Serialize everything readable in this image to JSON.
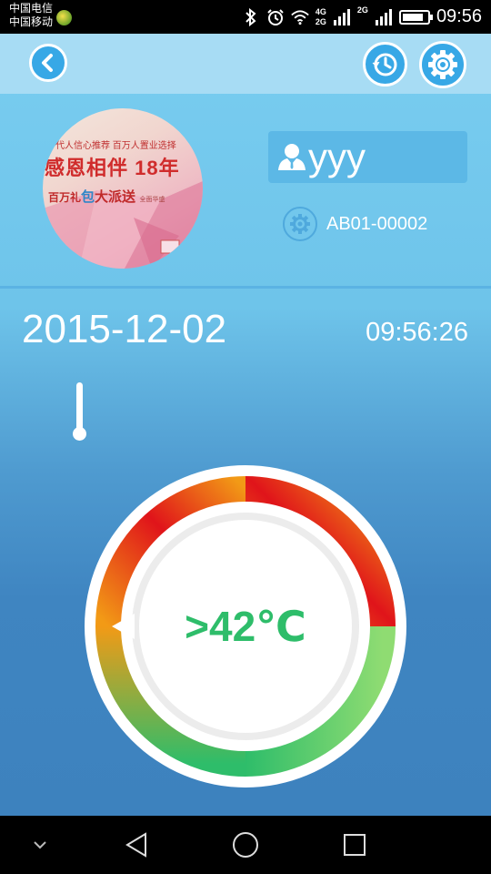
{
  "status_bar": {
    "carrier_1": "中国电信",
    "carrier_2": "中国移动",
    "net_4g_top": "4G",
    "net_4g_bottom": "2G",
    "net_2g": "2G",
    "time": "09:56",
    "battery_level": 0.85,
    "icons": [
      "bluetooth-icon",
      "alarm-icon",
      "wifi-icon",
      "signal-icon",
      "battery-icon"
    ]
  },
  "toolbar": {
    "back_icon": "chevron-left-icon",
    "history_icon": "history-clock-icon",
    "settings_icon": "gear-icon"
  },
  "profile": {
    "avatar_text": {
      "line1": "一代人信心推荐   百万人置业选择",
      "line2": "感恩相伴 18年",
      "line3_a": "百万礼",
      "line3_b": "包",
      "line3_c": "大派送",
      "line3_d": "全面华盛"
    },
    "user_name": "yyy",
    "device_id": "AB01-00002"
  },
  "reading": {
    "date": "2015-12-02",
    "time": "09:56:26",
    "temperature_display": ">42℃",
    "colors": {
      "low": "#2ebd6a",
      "mid": "#f29a16",
      "high": "#e0141a"
    }
  },
  "nav": {
    "items": [
      "collapse-icon",
      "back-triangle-icon",
      "home-circle-icon",
      "recents-square-icon"
    ]
  }
}
